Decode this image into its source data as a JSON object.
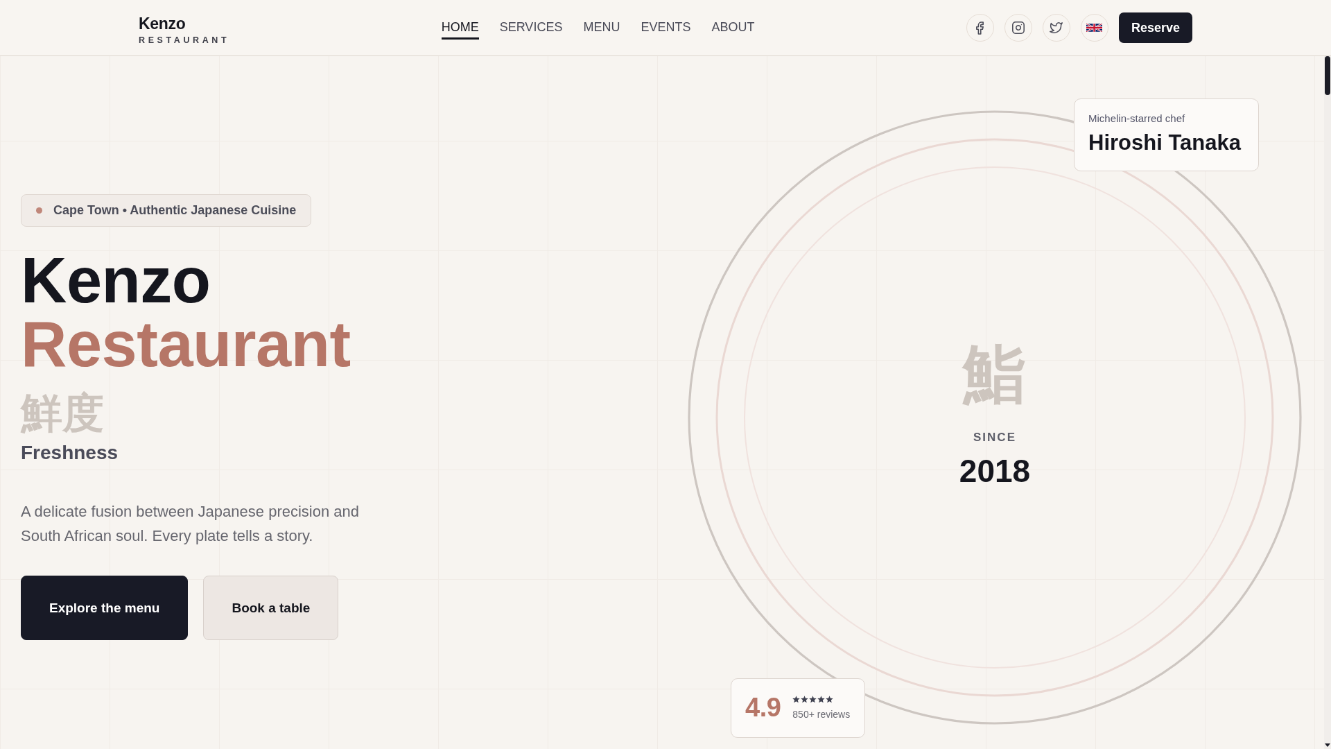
{
  "header": {
    "logo": {
      "name": "Kenzo",
      "tagline": "RESTAURANT"
    },
    "nav": [
      {
        "label": "HOME",
        "selected": true
      },
      {
        "label": "SERVICES",
        "selected": false
      },
      {
        "label": "MENU",
        "selected": false
      },
      {
        "label": "EVENTS",
        "selected": false
      },
      {
        "label": "ABOUT",
        "selected": false
      }
    ],
    "reserve_button": "Reserve"
  },
  "hero": {
    "location_tag": "Cape Town • Authentic Japanese Cuisine",
    "title": "Kenzo",
    "title_accent": "Restaurant",
    "kanji": "鮮度",
    "kanji_meaning": "Freshness",
    "description": "A delicate fusion between Japanese precision and South African soul. Every plate tells a story.",
    "buttons": [
      {
        "label": "Explore the menu",
        "kind": "primary"
      },
      {
        "label": "Book a table",
        "kind": "secondary"
      }
    ]
  },
  "plate": {
    "kanji": "鮨",
    "since_label": "SINCE",
    "year": "2018",
    "chef_card": {
      "caption": "Michelin-starred chef",
      "name": "Hiroshi Tanaka"
    },
    "rating": {
      "score": "4.9",
      "stars": 5,
      "reviews": "850+ reviews"
    }
  }
}
